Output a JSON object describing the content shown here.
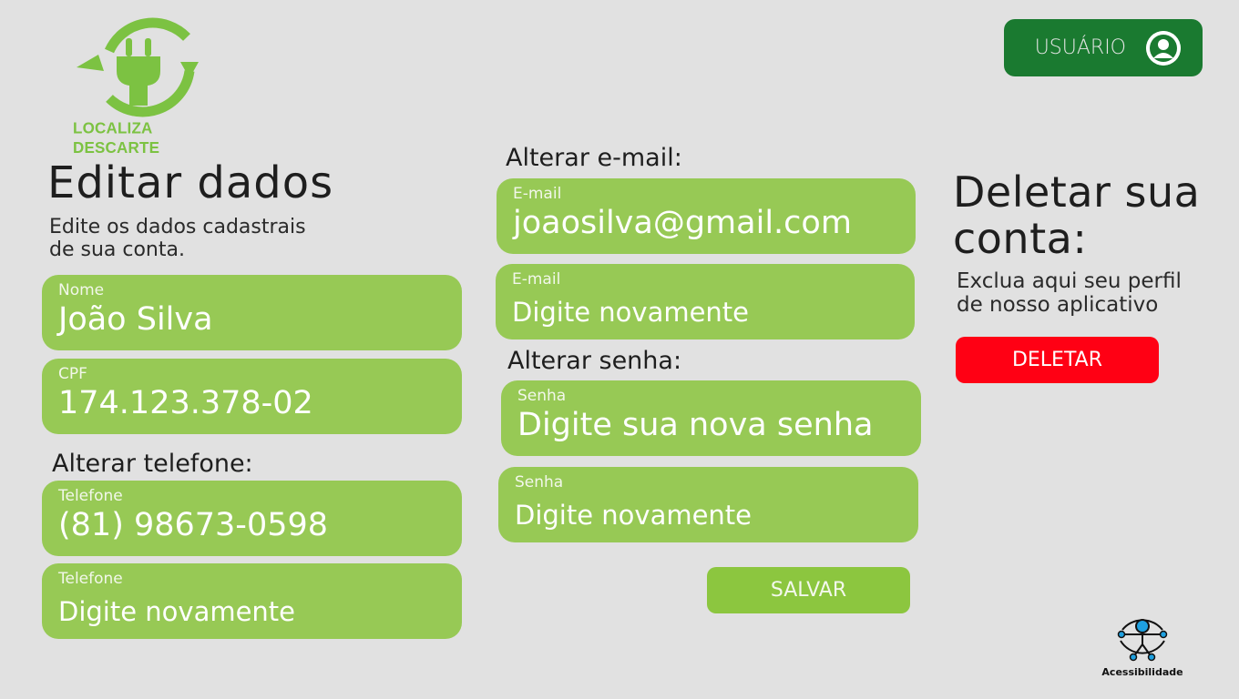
{
  "logo": {
    "text": "LOCALIZA DESCARTE"
  },
  "header": {
    "user_label": "USUÁRIO",
    "user_icon": "user-avatar-icon"
  },
  "edit": {
    "title": "Editar dados",
    "subtitle_line1": "Edite os dados cadastrais",
    "subtitle_line2": "de sua conta."
  },
  "fields": {
    "name": {
      "label": "Nome",
      "value": "João Silva"
    },
    "cpf": {
      "label": "CPF",
      "value": "174.123.378-02"
    },
    "phone_section": "Alterar telefone:",
    "phone": {
      "label": "Telefone",
      "value": "(81) 98673-0598"
    },
    "phone_confirm": {
      "label": "Telefone",
      "placeholder": "Digite novamente"
    },
    "email_section": "Alterar e-mail:",
    "email": {
      "label": "E-mail",
      "value": "joaosilva@gmail.com"
    },
    "email_confirm": {
      "label": "E-mail",
      "placeholder": "Digite novamente"
    },
    "password_section": "Alterar senha:",
    "password": {
      "label": "Senha",
      "value": "Digite sua nova senha"
    },
    "password_confirm": {
      "label": "Senha",
      "placeholder": "Digite novamente"
    }
  },
  "save_button": "SALVAR",
  "delete": {
    "title_line1": "Deletar sua",
    "title_line2": "conta:",
    "subtitle_line1": "Exclua aqui seu perfil",
    "subtitle_line2": "de nosso aplicativo",
    "button": "DELETAR"
  },
  "accessibility": {
    "label": "Acessibilidade",
    "icon": "accessibility-icon"
  },
  "colors": {
    "background": "#e1e1e1",
    "field_green": "#97c955",
    "save_green": "#8cc63f",
    "header_green": "#1a7a30",
    "logo_green": "#7cc242",
    "delete_red": "#ff0014",
    "accessibility_blue": "#1ea0e0"
  }
}
